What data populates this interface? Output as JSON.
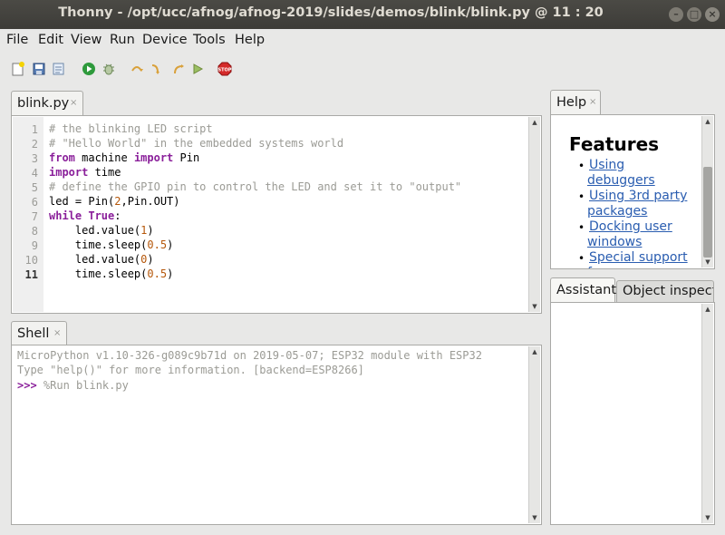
{
  "window": {
    "title": "Thonny  -  /opt/ucc/afnog/afnog-2019/slides/demos/blink/blink.py  @  11 : 20"
  },
  "menu": {
    "items": [
      "File",
      "Edit",
      "View",
      "Run",
      "Device",
      "Tools",
      "Help"
    ]
  },
  "toolbar": {
    "icons": [
      "new-file-icon",
      "open-file-icon",
      "save-file-icon",
      "run-icon",
      "debug-icon",
      "step-over-icon",
      "step-into-icon",
      "step-out-icon",
      "resume-icon",
      "stop-icon"
    ],
    "stop_text": "STOP"
  },
  "editor": {
    "tab_label": "blink.py",
    "tab_close": "×",
    "line_numbers": [
      "1",
      "2",
      "3",
      "4",
      "5",
      "6",
      "7",
      "8",
      "9",
      "10",
      "11"
    ],
    "lines": [
      [
        {
          "t": "# the blinking LED script",
          "c": "cm"
        }
      ],
      [
        {
          "t": "# \"Hello World\" in the embedded systems world",
          "c": "cm"
        }
      ],
      [
        {
          "t": "from",
          "c": "kw"
        },
        {
          "t": " machine ",
          "c": "nm"
        },
        {
          "t": "import",
          "c": "kw"
        },
        {
          "t": " Pin",
          "c": "nm"
        }
      ],
      [
        {
          "t": "import",
          "c": "kw"
        },
        {
          "t": " time",
          "c": "nm"
        }
      ],
      [
        {
          "t": "# define the GPIO pin to control the LED and set it to \"output\"",
          "c": "cm"
        }
      ],
      [
        {
          "t": "led = Pin(",
          "c": "nm"
        },
        {
          "t": "2",
          "c": "num"
        },
        {
          "t": ",Pin.OUT)",
          "c": "nm"
        }
      ],
      [
        {
          "t": "while",
          "c": "kw"
        },
        {
          "t": " ",
          "c": "nm"
        },
        {
          "t": "True",
          "c": "kw"
        },
        {
          "t": ":",
          "c": "nm"
        }
      ],
      [
        {
          "t": "    led.value(",
          "c": "nm"
        },
        {
          "t": "1",
          "c": "num"
        },
        {
          "t": ")",
          "c": "nm"
        }
      ],
      [
        {
          "t": "    time.sleep(",
          "c": "nm"
        },
        {
          "t": "0.5",
          "c": "num"
        },
        {
          "t": ")",
          "c": "nm"
        }
      ],
      [
        {
          "t": "    led.value(",
          "c": "nm"
        },
        {
          "t": "0",
          "c": "num"
        },
        {
          "t": ")",
          "c": "nm"
        }
      ],
      [
        {
          "t": "    time.sleep(",
          "c": "nm"
        },
        {
          "t": "0.5",
          "c": "num"
        },
        {
          "t": ")",
          "c": "nm"
        }
      ]
    ]
  },
  "shell": {
    "tab_label": "Shell",
    "tab_close": "×",
    "banner1": "MicroPython v1.10-326-g089c9b71d on 2019-05-07; ESP32 module with ESP32",
    "banner2": "Type \"help()\" for more information. [backend=ESP8266]",
    "prompt": ">>>",
    "command": " %Run blink.py"
  },
  "help": {
    "tab_label": "Help",
    "tab_close": "×",
    "heading": "Features",
    "links": [
      {
        "l1": "Using",
        "l2": "debuggers"
      },
      {
        "l1": "Using 3rd party",
        "l2": "packages"
      },
      {
        "l1": "Docking user",
        "l2": "windows"
      },
      {
        "l1": "Special support",
        "l2": "for ..."
      }
    ]
  },
  "assistant": {
    "tabs": [
      "Assistant",
      "Object inspecto"
    ]
  },
  "colors": {
    "keyword": "#8a1f9a",
    "comment": "#9b9b95",
    "number": "#b5570a",
    "link": "#2a5db0",
    "prompt": "#8a1f9a"
  }
}
